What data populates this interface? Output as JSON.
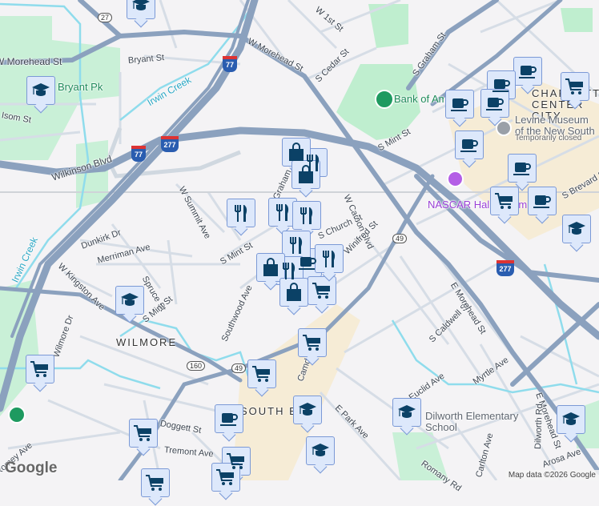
{
  "map": {
    "streets": [
      "W Morehead St",
      "Bryant St",
      "Isom St",
      "Wilkinson Blvd",
      "W Summit Ave",
      "W 1st St",
      "S Cedar St",
      "S Graham St",
      "S Mint St",
      "W Carson Blvd",
      "S Church St",
      "Winifred St",
      "S Brevard St",
      "S Caldwell St",
      "E Morehead St",
      "Myrtle Ave",
      "Euclid Ave",
      "E Park Ave",
      "Dilworth Rd",
      "Arosa Ave",
      "Carlton Ave",
      "Romany Rd",
      "Dunkirk Dr",
      "Merriman Ave",
      "W Kingston Ave",
      "Spruce St",
      "S Mint St",
      "Southwood Ave",
      "Wilmore Dr",
      "Doggett St",
      "Tremont Ave",
      "Camden Rd",
      "S Graham St",
      "Romey Ave"
    ],
    "parks": [
      "Bryant Pk",
      "Bank of America Stadium"
    ],
    "waterways": [
      "Irwin Creek",
      "Irwin Creek"
    ],
    "neighborhoods": [
      "WILMORE",
      "SOUTH END",
      "CHARLOTTE CENTER CITY"
    ],
    "pois": {
      "levine_museum": "Levine Museum of the New South",
      "levine_status": "Temporarily closed",
      "nascar": "NASCAR Hall of Fame",
      "dilworth_school": "Dilworth Elementary School"
    },
    "shields": {
      "us27": "27",
      "i77": "77",
      "i277": "277",
      "nc49": "49",
      "nc160": "160"
    }
  },
  "markers": [
    "school",
    "school",
    "school",
    "school",
    "school",
    "school",
    "school",
    "school",
    "coffee",
    "coffee",
    "coffee",
    "coffee",
    "coffee",
    "coffee",
    "coffee",
    "coffee",
    "coffee",
    "cart",
    "cart",
    "cart",
    "cart",
    "cart",
    "cart",
    "cart",
    "cart",
    "cart",
    "cart",
    "restaurant",
    "restaurant",
    "restaurant",
    "restaurant",
    "restaurant",
    "restaurant",
    "restaurant",
    "shopping",
    "shopping",
    "shopping",
    "shopping"
  ],
  "footer": {
    "logo": "Google",
    "attribution": "Map data ©2026 Google"
  },
  "colors": {
    "highway": "#8ba1be",
    "road": "#d6dde6",
    "park": "#c3efd2",
    "downtown": "#f6ecd6",
    "water": "#8fdcec",
    "marker": "#0b4166"
  }
}
